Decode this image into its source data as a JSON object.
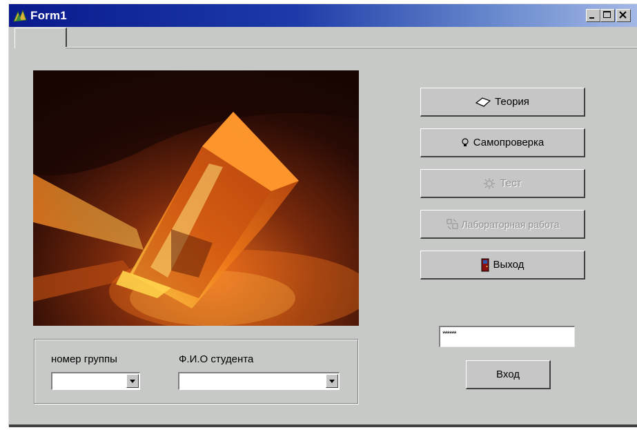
{
  "window": {
    "title": "Form1",
    "controls": {
      "minimize": "minimize",
      "maximize": "maximize",
      "close": "close"
    }
  },
  "main": {
    "buttons": [
      {
        "label": "Теория",
        "icon": "book-icon",
        "enabled": true
      },
      {
        "label": "Самопроверка",
        "icon": "lightbulb-icon",
        "enabled": true
      },
      {
        "label": "Тест",
        "icon": "light-burst-icon",
        "enabled": false
      },
      {
        "label": "Лабораторная работа",
        "icon": "lab-icon",
        "enabled": false
      },
      {
        "label": "Выход",
        "icon": "exit-door-icon",
        "enabled": true
      }
    ],
    "group": {
      "group_label": "номер группы",
      "group_value": "",
      "student_label": "Ф.И.О студента",
      "student_value": ""
    },
    "password": {
      "value": "******"
    },
    "login_button": "Вход"
  },
  "colors": {
    "titlebar_start": "#0a1a8c",
    "titlebar_end": "#a4b8e6",
    "face": "#c6c9c6"
  }
}
